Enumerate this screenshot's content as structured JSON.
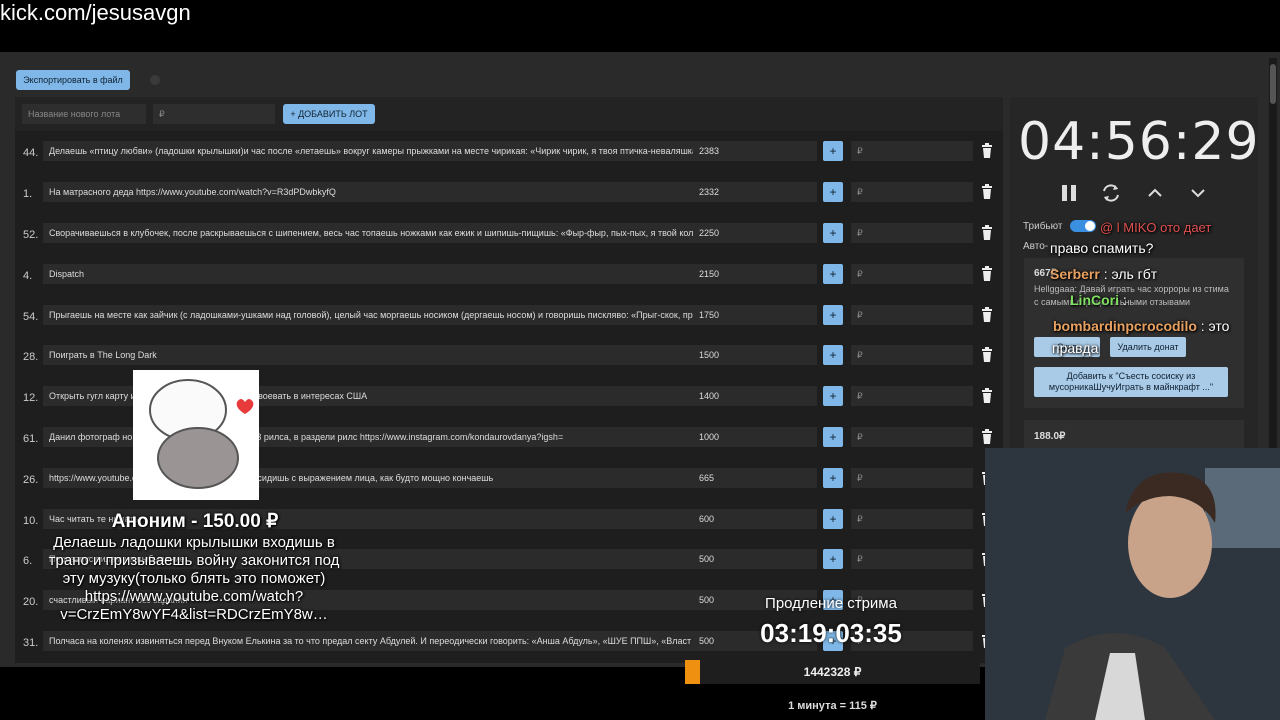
{
  "url": "kick.com/jesusavgn",
  "toolbar": {
    "export_label": "Экспортировать в файл"
  },
  "add_lot": {
    "name_placeholder": "Название нового лота",
    "price_placeholder": "₽",
    "add_label": "+ ДОБАВИТЬ ЛОТ"
  },
  "lots": [
    {
      "num": "44.",
      "title": "Делаешь «птицу любви» (ладошки крылышки)и час после «летаешь» вокруг камеры прыжками на месте чирикая: «Чирик чирик, я твоя птичка-неваляшка",
      "amount": "2383",
      "plus": "+",
      "rub": "₽"
    },
    {
      "num": "1.",
      "title": "На матрасного деда https://www.youtube.com/watch?v=R3dPDwbkyfQ",
      "amount": "2332",
      "plus": "+",
      "rub": "₽"
    },
    {
      "num": "52.",
      "title": "Сворачиваешься в клубочек, после раскрываешься с шипением, весь час топаешь ножками как ежик и шипишь-пищишь: «Фыр-фыр, пых-пых, я твой колючий",
      "amount": "2250",
      "plus": "+",
      "rub": "₽"
    },
    {
      "num": "4.",
      "title": "Dispatch",
      "amount": "2150",
      "plus": "+",
      "rub": "₽"
    },
    {
      "num": "54.",
      "title": "Прыгаешь на месте как зайчик (с ладошками-ушками над головой), целый час моргаешь носиком (дергаешь носом) и говоришь писклявo: «Прыг-скок, пры",
      "amount": "1750",
      "plus": "+",
      "rub": "₽"
    },
    {
      "num": "28.",
      "title": "Поиграть в The Long Dark",
      "amount": "1500",
      "plus": "+",
      "rub": "₽"
    },
    {
      "num": "12.",
      "title": "Открыть гугл карту и                                  следующую страну нужно отвоевать в интересах США",
      "amount": "1400",
      "plus": "+",
      "rub": "₽"
    },
    {
      "num": "61.",
      "title": "Данил фотограф но                                   грамм И посмотрети первые 3 рилса, в раздели рилс https://www.instagram.com/kondaurovdanya?igsh=",
      "amount": "1000",
      "plus": "+",
      "rub": "₽"
    },
    {
      "num": "26.",
      "title": "https://www.youtube.c                                   тить 29 минут. все 29 минут сидишь с выражением лица, как будто мощно кончаешь",
      "amount": "665",
      "plus": "+",
      "rub": "₽"
    },
    {
      "num": "10.",
      "title": "Час читать те                                         нимать",
      "amount": "600",
      "plus": "+",
      "rub": "₽"
    },
    {
      "num": "6.",
      "title": "Перезапус                                                       вилам на выбывание",
      "amount": "500",
      "plus": "+",
      "rub": "₽"
    },
    {
      "num": "20.",
      "title": "счастливый вариант без задания",
      "amount": "500",
      "plus": "+",
      "rub": "₽"
    },
    {
      "num": "31.",
      "title": "Полчаса на коленях извиняться перед Внуком Елькина за то что предал секту Абдулей. И переодически говорить: «Анша Абдуль», «ШУЕ ППШ», «Власт",
      "amount": "500",
      "plus": "+",
      "rub": "₽"
    }
  ],
  "timer": {
    "time": "04:56:29"
  },
  "sidebar": {
    "tribute_label": "Трибьют",
    "auto_label": "Авто-",
    "donation_amount": "667₽",
    "donation_text": "Hellggaaa: Давай играть час хорроры из стима с самыми отрицательными отзывами",
    "skip_label": "Скип",
    "delete_label": "Удалить донат",
    "add_to_label": "Добавить к \"Съесть сосиску из мусорникаШучуИграть в майнкрафт ...\"",
    "donation2_amount": "188.0₽"
  },
  "chat": [
    {
      "user": "",
      "text": "право спамить?",
      "color": "#ffffff"
    },
    {
      "user": "Serberr",
      "text": " : эль гбт",
      "color": "#e8a060"
    },
    {
      "user": "LinCori",
      "text": " :",
      "color": "#7fe060"
    },
    {
      "user": "bombardinpcrocodilo",
      "text": " : это",
      "color": "#e8a060"
    },
    {
      "user": "",
      "text": "правда",
      "color": "#ffffff"
    }
  ],
  "chat_top": "@ l MIKO ото дает",
  "alert": {
    "title": "Аноним - 150.00 ₽",
    "message": "Делаешь ладошки крылышки входишь в трано и призываешь войну законится под эту музуку(только блять это поможет) https://www.youtube.com/watch?v=CrzEmY8wYF4&list=RDCrzEmY8w…"
  },
  "extension": {
    "label": "Продление стрима",
    "time": "03:19:03:35"
  },
  "progress": {
    "text": "1442328 ₽",
    "fraction": 0.05
  },
  "rate": "1 минута = 115 ₽"
}
